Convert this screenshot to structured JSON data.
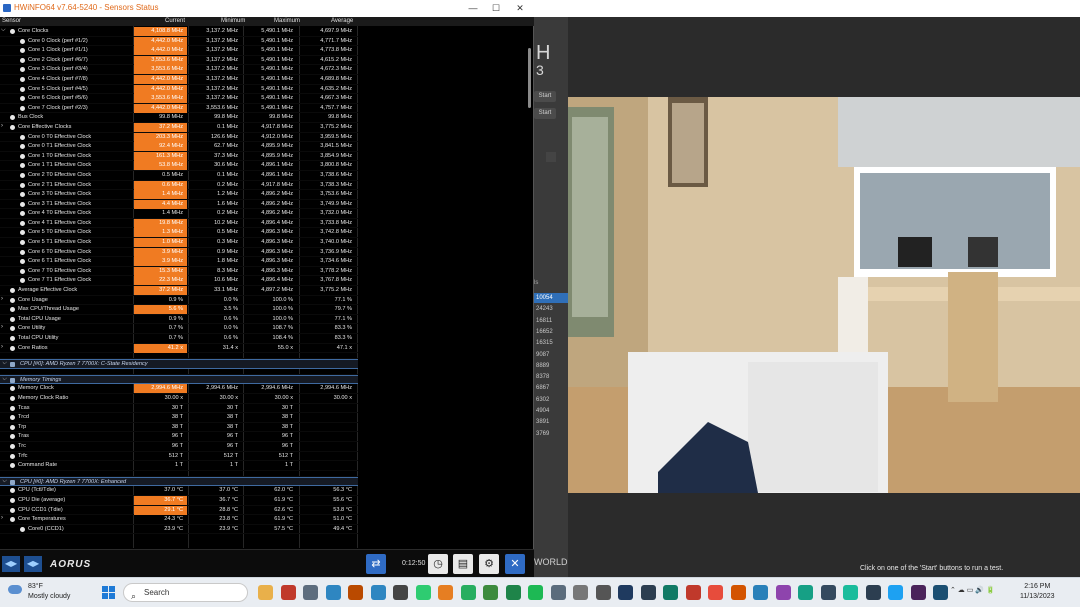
{
  "window": {
    "title": "HWiNFO64 v7.64-5240 - Sensors Status",
    "minimize": "—",
    "maximize": "☐",
    "close": "✕"
  },
  "columns": [
    "Sensor",
    "Current",
    "Minimum",
    "Maximum",
    "Average"
  ],
  "rows": [
    {
      "indent": 1,
      "type": "expander",
      "name": "Core Clocks",
      "cur": "4,108.8 MHz",
      "min": "3,137.2 MHz",
      "max": "5,490.1 MHz",
      "avg": "4,697.9 MHz",
      "hot": true
    },
    {
      "indent": 2,
      "type": "dot",
      "name": "Core 0 Clock (perf #1/2)",
      "cur": "4,442.0 MHz",
      "min": "3,137.2 MHz",
      "max": "5,490.1 MHz",
      "avg": "4,771.7 MHz",
      "hot": true
    },
    {
      "indent": 2,
      "type": "dot",
      "name": "Core 1 Clock (perf #1/1)",
      "cur": "4,442.0 MHz",
      "min": "3,137.2 MHz",
      "max": "5,490.1 MHz",
      "avg": "4,773.8 MHz",
      "hot": true
    },
    {
      "indent": 2,
      "type": "dot",
      "name": "Core 2 Clock (perf #6/7)",
      "cur": "3,553.6 MHz",
      "min": "3,137.2 MHz",
      "max": "5,490.1 MHz",
      "avg": "4,615.2 MHz",
      "hot": true
    },
    {
      "indent": 2,
      "type": "dot",
      "name": "Core 3 Clock (perf #3/4)",
      "cur": "3,553.6 MHz",
      "min": "3,137.2 MHz",
      "max": "5,490.1 MHz",
      "avg": "4,672.3 MHz",
      "hot": true
    },
    {
      "indent": 2,
      "type": "dot",
      "name": "Core 4 Clock (perf #7/8)",
      "cur": "4,442.0 MHz",
      "min": "3,137.2 MHz",
      "max": "5,490.1 MHz",
      "avg": "4,689.8 MHz",
      "hot": true
    },
    {
      "indent": 2,
      "type": "dot",
      "name": "Core 5 Clock (perf #4/5)",
      "cur": "4,442.0 MHz",
      "min": "3,137.2 MHz",
      "max": "5,490.1 MHz",
      "avg": "4,635.2 MHz",
      "hot": true
    },
    {
      "indent": 2,
      "type": "dot",
      "name": "Core 6 Clock (perf #5/6)",
      "cur": "3,553.6 MHz",
      "min": "3,137.2 MHz",
      "max": "5,490.1 MHz",
      "avg": "4,667.3 MHz",
      "hot": true
    },
    {
      "indent": 2,
      "type": "dot",
      "name": "Core 7 Clock (perf #2/3)",
      "cur": "4,442.0 MHz",
      "min": "3,553.6 MHz",
      "max": "5,490.1 MHz",
      "avg": "4,757.7 MHz",
      "hot": true
    },
    {
      "indent": 1,
      "type": "dot",
      "name": "Bus Clock",
      "cur": "99.8 MHz",
      "min": "99.8 MHz",
      "max": "99.8 MHz",
      "avg": "99.8 MHz",
      "hot": false
    },
    {
      "indent": 1,
      "type": "expander",
      "name": "Core Effective Clocks",
      "cur": "37.2 MHz",
      "min": "0.1 MHz",
      "max": "4,917.8 MHz",
      "avg": "3,775.2 MHz",
      "hot": true
    },
    {
      "indent": 2,
      "type": "dot",
      "name": "Core 0 T0 Effective Clock",
      "cur": "203.3 MHz",
      "min": "126.6 MHz",
      "max": "4,912.0 MHz",
      "avg": "3,959.5 MHz",
      "hot": true
    },
    {
      "indent": 2,
      "type": "dot",
      "name": "Core 0 T1 Effective Clock",
      "cur": "92.4 MHz",
      "min": "62.7 MHz",
      "max": "4,895.9 MHz",
      "avg": "3,841.5 MHz",
      "hot": true
    },
    {
      "indent": 2,
      "type": "dot",
      "name": "Core 1 T0 Effective Clock",
      "cur": "161.3 MHz",
      "min": "37.3 MHz",
      "max": "4,895.9 MHz",
      "avg": "3,854.9 MHz",
      "hot": true
    },
    {
      "indent": 2,
      "type": "dot",
      "name": "Core 1 T1 Effective Clock",
      "cur": "53.8 MHz",
      "min": "30.6 MHz",
      "max": "4,896.1 MHz",
      "avg": "3,800.8 MHz",
      "hot": true
    },
    {
      "indent": 2,
      "type": "dot",
      "name": "Core 2 T0 Effective Clock",
      "cur": "0.5 MHz",
      "min": "0.1 MHz",
      "max": "4,896.1 MHz",
      "avg": "3,738.6 MHz",
      "hot": false
    },
    {
      "indent": 2,
      "type": "dot",
      "name": "Core 2 T1 Effective Clock",
      "cur": "0.6 MHz",
      "min": "0.2 MHz",
      "max": "4,917.8 MHz",
      "avg": "3,738.3 MHz",
      "hot": true
    },
    {
      "indent": 2,
      "type": "dot",
      "name": "Core 3 T0 Effective Clock",
      "cur": "1.4 MHz",
      "min": "1.2 MHz",
      "max": "4,896.2 MHz",
      "avg": "3,753.6 MHz",
      "hot": true
    },
    {
      "indent": 2,
      "type": "dot",
      "name": "Core 3 T1 Effective Clock",
      "cur": "4.4 MHz",
      "min": "1.6 MHz",
      "max": "4,896.2 MHz",
      "avg": "3,749.9 MHz",
      "hot": true
    },
    {
      "indent": 2,
      "type": "dot",
      "name": "Core 4 T0 Effective Clock",
      "cur": "1.4 MHz",
      "min": "0.2 MHz",
      "max": "4,896.2 MHz",
      "avg": "3,732.0 MHz",
      "hot": false
    },
    {
      "indent": 2,
      "type": "dot",
      "name": "Core 4 T1 Effective Clock",
      "cur": "19.8 MHz",
      "min": "10.2 MHz",
      "max": "4,896.4 MHz",
      "avg": "3,733.8 MHz",
      "hot": true
    },
    {
      "indent": 2,
      "type": "dot",
      "name": "Core 5 T0 Effective Clock",
      "cur": "1.3 MHz",
      "min": "0.5 MHz",
      "max": "4,896.3 MHz",
      "avg": "3,742.8 MHz",
      "hot": true
    },
    {
      "indent": 2,
      "type": "dot",
      "name": "Core 5 T1 Effective Clock",
      "cur": "1.0 MHz",
      "min": "0.3 MHz",
      "max": "4,896.3 MHz",
      "avg": "3,740.0 MHz",
      "hot": true
    },
    {
      "indent": 2,
      "type": "dot",
      "name": "Core 6 T0 Effective Clock",
      "cur": "3.9 MHz",
      "min": "0.9 MHz",
      "max": "4,896.3 MHz",
      "avg": "3,736.9 MHz",
      "hot": true
    },
    {
      "indent": 2,
      "type": "dot",
      "name": "Core 6 T1 Effective Clock",
      "cur": "3.9 MHz",
      "min": "1.8 MHz",
      "max": "4,896.3 MHz",
      "avg": "3,734.6 MHz",
      "hot": true
    },
    {
      "indent": 2,
      "type": "dot",
      "name": "Core 7 T0 Effective Clock",
      "cur": "15.3 MHz",
      "min": "8.3 MHz",
      "max": "4,896.3 MHz",
      "avg": "3,778.2 MHz",
      "hot": true
    },
    {
      "indent": 2,
      "type": "dot",
      "name": "Core 7 T1 Effective Clock",
      "cur": "22.3 MHz",
      "min": "10.6 MHz",
      "max": "4,896.4 MHz",
      "avg": "3,767.8 MHz",
      "hot": true
    },
    {
      "indent": 1,
      "type": "dot",
      "name": "Average Effective Clock",
      "cur": "37.2 MHz",
      "min": "33.1 MHz",
      "max": "4,897.2 MHz",
      "avg": "3,775.2 MHz",
      "hot": true
    },
    {
      "indent": 1,
      "type": "expander",
      "name": "Core Usage",
      "cur": "0.9 %",
      "min": "0.0 %",
      "max": "100.0 %",
      "avg": "77.1 %",
      "hot": false
    },
    {
      "indent": 1,
      "type": "dot",
      "name": "Max CPU/Thread Usage",
      "cur": "5.6 %",
      "min": "3.5 %",
      "max": "100.0 %",
      "avg": "79.7 %",
      "hot": true
    },
    {
      "indent": 1,
      "type": "dot",
      "name": "Total CPU Usage",
      "cur": "0.9 %",
      "min": "0.6 %",
      "max": "100.0 %",
      "avg": "77.1 %",
      "hot": false
    },
    {
      "indent": 1,
      "type": "expander",
      "name": "Core Utility",
      "cur": "0.7 %",
      "min": "0.0 %",
      "max": "108.7 %",
      "avg": "83.3 %",
      "hot": false
    },
    {
      "indent": 1,
      "type": "dot",
      "name": "Total CPU Utility",
      "cur": "0.7 %",
      "min": "0.6 %",
      "max": "108.4 %",
      "avg": "83.3 %",
      "hot": false
    },
    {
      "indent": 1,
      "type": "expander",
      "name": "Core Ratios",
      "cur": "41.2 x",
      "min": "31.4 x",
      "max": "55.0 x",
      "avg": "47.1 x",
      "hot": true
    },
    {
      "type": "gap"
    },
    {
      "type": "section",
      "name": "CPU [#0]: AMD Ryzen 7 7700X: C-State Residency"
    },
    {
      "type": "gap"
    },
    {
      "type": "section",
      "name": "Memory Timings"
    },
    {
      "indent": 1,
      "type": "dot",
      "name": "Memory Clock",
      "cur": "2,994.6 MHz",
      "min": "2,994.6 MHz",
      "max": "2,994.6 MHz",
      "avg": "2,994.6 MHz",
      "hot": true
    },
    {
      "indent": 1,
      "type": "dot",
      "name": "Memory Clock Ratio",
      "cur": "30.00 x",
      "min": "30.00 x",
      "max": "30.00 x",
      "avg": "30.00 x",
      "hot": false
    },
    {
      "indent": 1,
      "type": "dot",
      "name": "Tcas",
      "cur": "30 T",
      "min": "30 T",
      "max": "30 T",
      "avg": "",
      "hot": false
    },
    {
      "indent": 1,
      "type": "dot",
      "name": "Trcd",
      "cur": "38 T",
      "min": "38 T",
      "max": "38 T",
      "avg": "",
      "hot": false
    },
    {
      "indent": 1,
      "type": "dot",
      "name": "Trp",
      "cur": "38 T",
      "min": "38 T",
      "max": "38 T",
      "avg": "",
      "hot": false
    },
    {
      "indent": 1,
      "type": "dot",
      "name": "Tras",
      "cur": "96 T",
      "min": "96 T",
      "max": "96 T",
      "avg": "",
      "hot": false
    },
    {
      "indent": 1,
      "type": "dot",
      "name": "Trc",
      "cur": "96 T",
      "min": "96 T",
      "max": "96 T",
      "avg": "",
      "hot": false
    },
    {
      "indent": 1,
      "type": "dot",
      "name": "Trfc",
      "cur": "512 T",
      "min": "512 T",
      "max": "512 T",
      "avg": "",
      "hot": false
    },
    {
      "indent": 1,
      "type": "dot",
      "name": "Command Rate",
      "cur": "1 T",
      "min": "1 T",
      "max": "1 T",
      "avg": "",
      "hot": false
    },
    {
      "type": "gap"
    },
    {
      "type": "section",
      "name": "CPU [#0]: AMD Ryzen 7 7700X: Enhanced"
    },
    {
      "indent": 1,
      "type": "dot",
      "name": "CPU (Tctl/Tdie)",
      "cur": "37.0 °C",
      "min": "37.0 °C",
      "max": "62.0 °C",
      "avg": "56.3 °C",
      "hot": false
    },
    {
      "indent": 1,
      "type": "dot",
      "name": "CPU Die (average)",
      "cur": "36.7 °C",
      "min": "36.7 °C",
      "max": "61.9 °C",
      "avg": "55.6 °C",
      "hot": true
    },
    {
      "indent": 1,
      "type": "dot",
      "name": "CPU CCD1 (Tdie)",
      "cur": "29.1 °C",
      "min": "28.8 °C",
      "max": "62.6 °C",
      "avg": "53.8 °C",
      "hot": true
    },
    {
      "indent": 1,
      "type": "expander",
      "name": "Core Temperatures",
      "cur": "24.3 °C",
      "min": "23.8 °C",
      "max": "61.9 °C",
      "avg": "51.0 °C",
      "hot": false
    },
    {
      "indent": 2,
      "type": "dot",
      "name": "Core0 (CCD1)",
      "cur": "23.9 °C",
      "min": "23.9 °C",
      "max": "57.5 °C",
      "avg": "49.4 °C",
      "hot": false
    }
  ],
  "footer": {
    "elapsed": "0:12:50",
    "brand": "AORUS"
  },
  "background": {
    "big_letter_1": "H",
    "big_letter_2": "3",
    "start_1": "Start",
    "start_2": "Start",
    "scores": [
      "10054",
      "24243",
      "16811",
      "16652",
      "16315",
      "9087",
      "8889",
      "8378",
      "6867",
      "6302",
      "4904",
      "3891",
      "3769"
    ],
    "scores_label": "ls",
    "world": "WORLD",
    "hint": "Click on one of the 'Start' buttons to run a test."
  },
  "taskbar": {
    "temp": "83°F",
    "weather": "Mostly cloudy",
    "search": "Search",
    "time": "2:16 PM",
    "date": "11/13/2023"
  },
  "colors": {
    "hot": "#f07b22",
    "section": "#3f6aa0",
    "accent_blue": "#2f6bc4"
  }
}
